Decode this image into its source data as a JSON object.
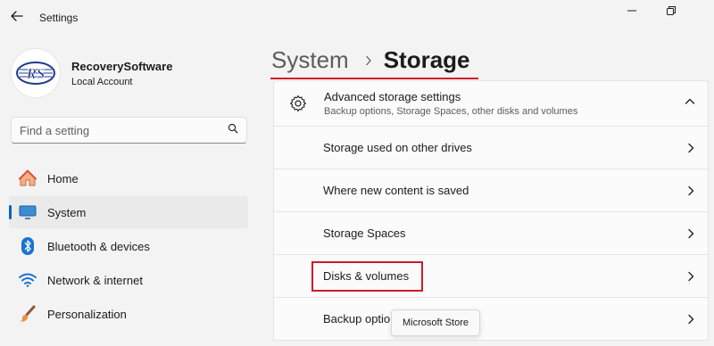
{
  "window": {
    "title": "Settings",
    "back_icon": "arrow-left-icon",
    "minimize_icon": "minimize-icon",
    "restore_icon": "restore-icon"
  },
  "profile": {
    "name": "RecoverySoftware",
    "account_type": "Local Account",
    "avatar_text": "RS"
  },
  "search": {
    "placeholder": "Find a setting",
    "icon": "search-icon"
  },
  "sidebar": {
    "items": [
      {
        "label": "Home",
        "icon": "home-icon",
        "active": false
      },
      {
        "label": "System",
        "icon": "monitor-icon",
        "active": true
      },
      {
        "label": "Bluetooth & devices",
        "icon": "bluetooth-icon",
        "active": false
      },
      {
        "label": "Network & internet",
        "icon": "wifi-icon",
        "active": false
      },
      {
        "label": "Personalization",
        "icon": "brush-icon",
        "active": false
      }
    ]
  },
  "breadcrumb": {
    "parent": "System",
    "separator_icon": "chevron-right-icon",
    "current": "Storage"
  },
  "advanced": {
    "title": "Advanced storage settings",
    "subtitle": "Backup options, Storage Spaces, other disks and volumes",
    "icon": "gear-icon",
    "expanded": true
  },
  "rows": [
    {
      "label": "Storage used on other drives"
    },
    {
      "label": "Where new content is saved"
    },
    {
      "label": "Storage Spaces"
    },
    {
      "label": "Disks & volumes",
      "highlighted": true
    },
    {
      "label": "Backup optio"
    }
  ],
  "tooltip": {
    "text": "Microsoft Store"
  },
  "colors": {
    "accent": "#0067c0",
    "highlight": "#d11a2a",
    "background": "#f3f3f3",
    "card": "#fbfbfb"
  }
}
